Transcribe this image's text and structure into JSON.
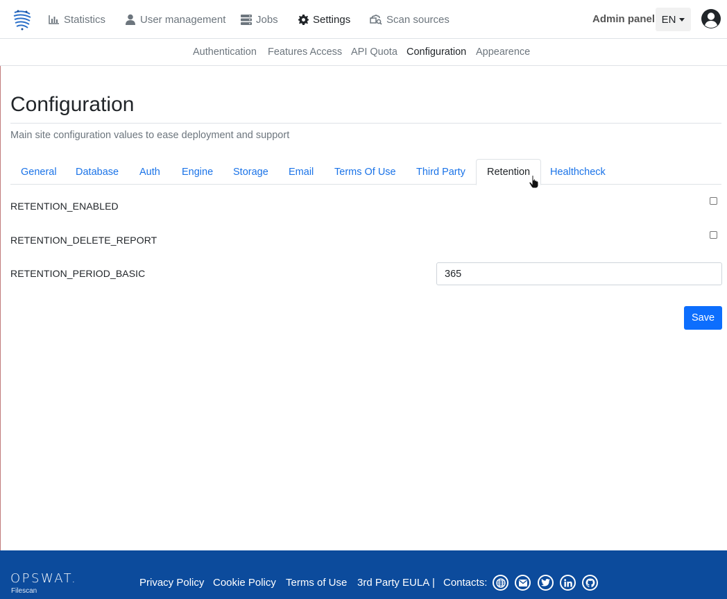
{
  "navbar": {
    "items": [
      {
        "label": "Statistics",
        "icon": "bar-chart-icon"
      },
      {
        "label": "User management",
        "icon": "user-icon"
      },
      {
        "label": "Jobs",
        "icon": "server-icon"
      },
      {
        "label": "Settings",
        "icon": "gear-icon"
      },
      {
        "label": "Scan sources",
        "icon": "cloud-scan-icon"
      }
    ],
    "active": "Settings",
    "admin_label": "Admin panel",
    "language": "EN"
  },
  "subnav": {
    "items": [
      "Authentication",
      "Features Access",
      "API Quota",
      "Configuration",
      "Appearence"
    ],
    "active": "Configuration"
  },
  "main": {
    "title": "Configuration",
    "subtitle": "Main site configuration values to ease deployment and support",
    "tabs": [
      "General",
      "Database",
      "Auth",
      "Engine",
      "Storage",
      "Email",
      "Terms Of Use",
      "Third Party",
      "Retention",
      "Healthcheck"
    ],
    "active_tab": "Retention",
    "fields": [
      {
        "label": "RETENTION_ENABLED",
        "type": "checkbox",
        "checked": false
      },
      {
        "label": "RETENTION_DELETE_REPORT",
        "type": "checkbox",
        "checked": false
      },
      {
        "label": "RETENTION_PERIOD_BASIC",
        "type": "number",
        "value": "365"
      }
    ],
    "save_label": "Save"
  },
  "footer": {
    "brand": "OPSWAT.",
    "brand_sub": "Filescan",
    "links": [
      "Privacy Policy",
      "Cookie Policy",
      "Terms of Use",
      "3rd Party EULA"
    ],
    "separator": "|",
    "contacts_label": "Contacts:",
    "contact_icons": [
      "globe-icon",
      "mail-icon",
      "twitter-icon",
      "linkedin-icon",
      "github-icon"
    ]
  },
  "colors": {
    "link": "#1a73e8",
    "primary_button": "#0d6efd",
    "footer_bg": "#0c4b9c"
  }
}
